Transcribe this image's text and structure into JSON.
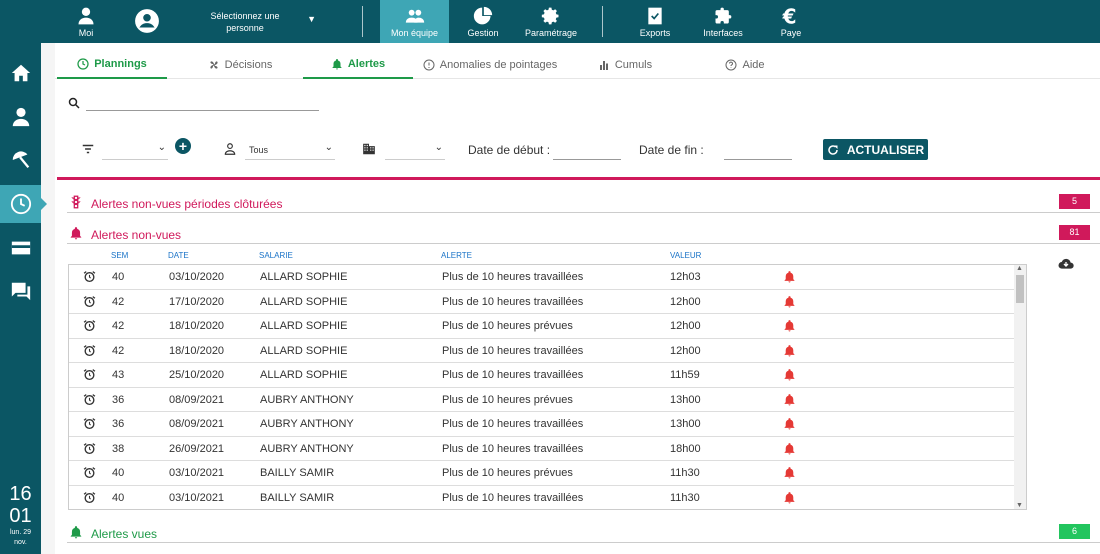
{
  "topbar": {
    "moi": "Moi",
    "person_select": "Sélectionnez une personne",
    "mon_equipe": "Mon équipe",
    "gestion": "Gestion",
    "parametrage": "Paramétrage",
    "exports": "Exports",
    "interfaces": "Interfaces",
    "paye": "Paye"
  },
  "clock": {
    "hours": "16",
    "minutes": "01",
    "day": "lun. 29",
    "month": "nov."
  },
  "tabs": [
    {
      "label": "Plannings"
    },
    {
      "label": "Décisions"
    },
    {
      "label": "Alertes"
    },
    {
      "label": "Anomalies de pointages"
    },
    {
      "label": "Cumuls"
    },
    {
      "label": "Aide"
    }
  ],
  "filters": {
    "tous": "Tous",
    "date_debut": "Date de début :",
    "date_fin": "Date de fin :",
    "actualiser": "ACTUALISER"
  },
  "sections": {
    "closed": {
      "title": "Alertes non-vues périodes clôturées",
      "count": "5"
    },
    "unseen": {
      "title": "Alertes non-vues",
      "count": "81"
    },
    "seen": {
      "title": "Alertes vues",
      "count": "6"
    }
  },
  "colors": {
    "primary": "#0b5664",
    "accent": "#3ea6b5",
    "alert": "#d0195b",
    "green": "#1e9a48",
    "badge_green": "#22c55e"
  },
  "table": {
    "headers": {
      "sem": "SEM",
      "date": "DATE",
      "salarie": "SALARIE",
      "alerte": "ALERTE",
      "valeur": "VALEUR"
    },
    "rows": [
      {
        "sem": "40",
        "date": "03/10/2020",
        "salarie": "ALLARD SOPHIE",
        "alerte": "Plus de 10 heures travaillées",
        "valeur": "12h03"
      },
      {
        "sem": "42",
        "date": "17/10/2020",
        "salarie": "ALLARD SOPHIE",
        "alerte": "Plus de 10 heures travaillées",
        "valeur": "12h00"
      },
      {
        "sem": "42",
        "date": "18/10/2020",
        "salarie": "ALLARD SOPHIE",
        "alerte": "Plus de 10 heures prévues",
        "valeur": "12h00"
      },
      {
        "sem": "42",
        "date": "18/10/2020",
        "salarie": "ALLARD SOPHIE",
        "alerte": "Plus de 10 heures travaillées",
        "valeur": "12h00"
      },
      {
        "sem": "43",
        "date": "25/10/2020",
        "salarie": "ALLARD SOPHIE",
        "alerte": "Plus de 10 heures travaillées",
        "valeur": "11h59"
      },
      {
        "sem": "36",
        "date": "08/09/2021",
        "salarie": "AUBRY ANTHONY",
        "alerte": "Plus de 10 heures prévues",
        "valeur": "13h00"
      },
      {
        "sem": "36",
        "date": "08/09/2021",
        "salarie": "AUBRY ANTHONY",
        "alerte": "Plus de 10 heures travaillées",
        "valeur": "13h00"
      },
      {
        "sem": "38",
        "date": "26/09/2021",
        "salarie": "AUBRY ANTHONY",
        "alerte": "Plus de 10 heures travaillées",
        "valeur": "18h00"
      },
      {
        "sem": "40",
        "date": "03/10/2021",
        "salarie": "BAILLY SAMIR",
        "alerte": "Plus de 10 heures prévues",
        "valeur": "11h30"
      },
      {
        "sem": "40",
        "date": "03/10/2021",
        "salarie": "BAILLY SAMIR",
        "alerte": "Plus de 10 heures travaillées",
        "valeur": "11h30"
      }
    ]
  }
}
